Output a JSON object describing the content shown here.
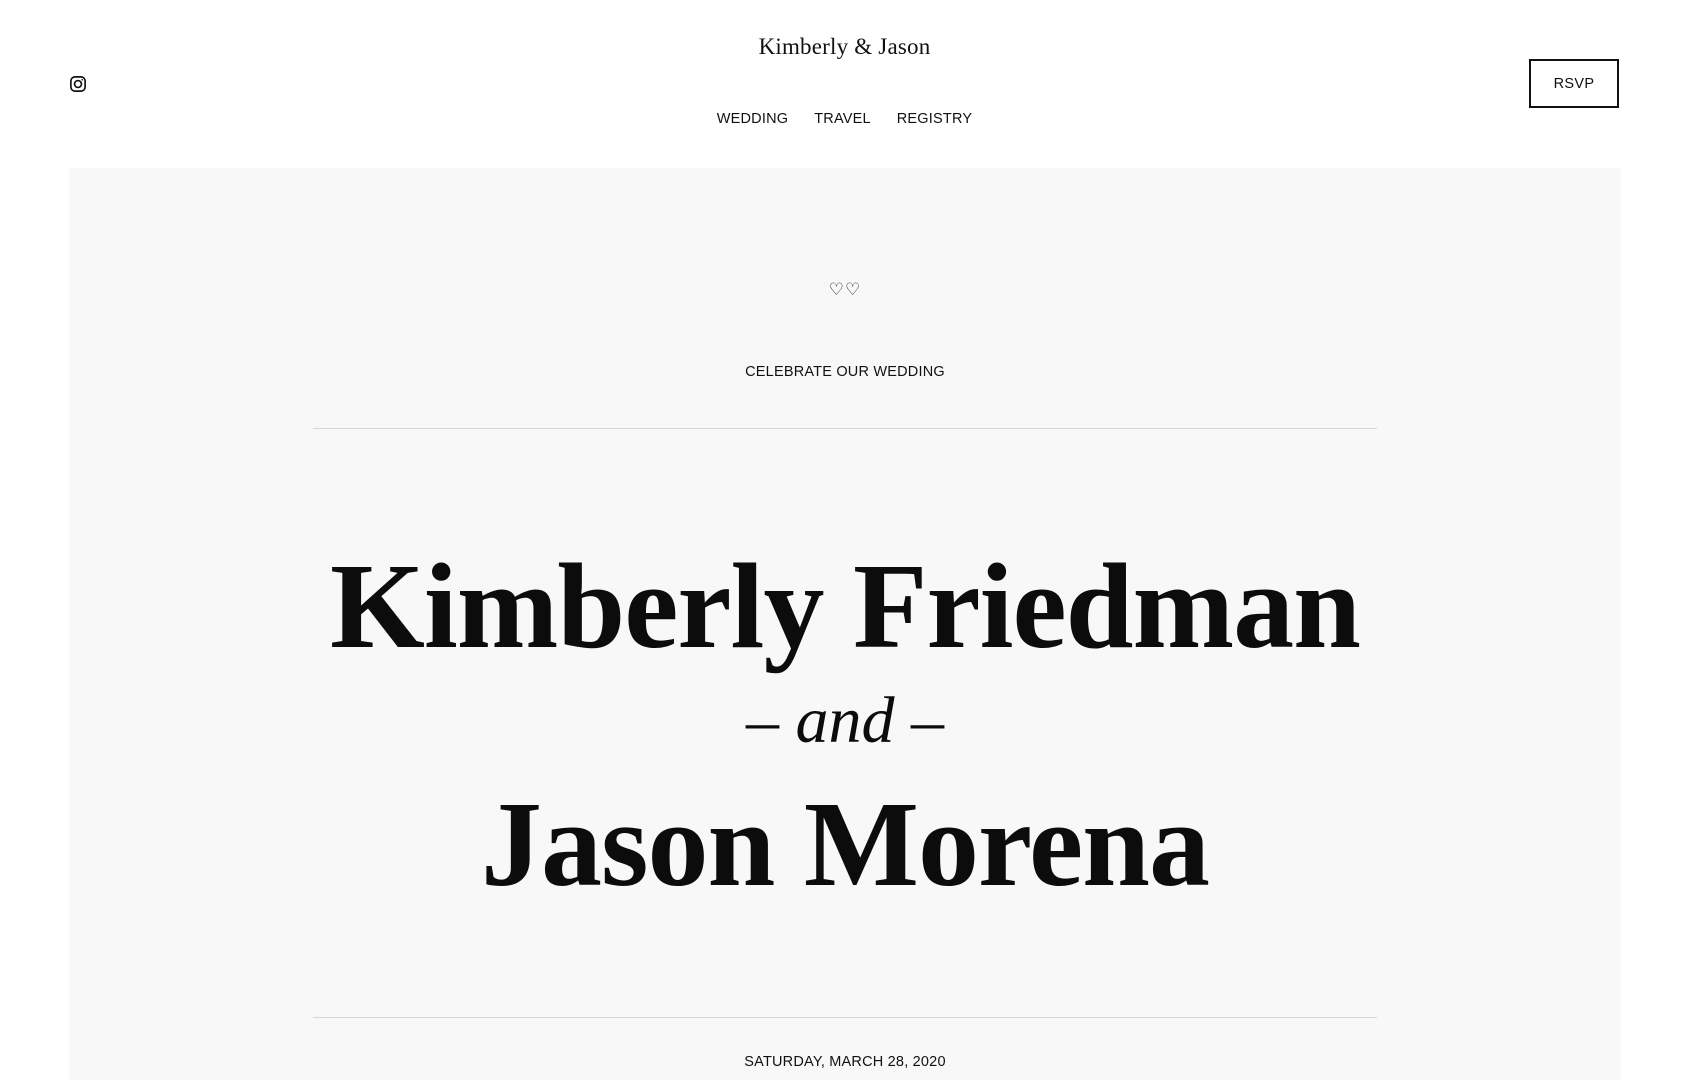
{
  "header": {
    "site_title": "Kimberly & Jason",
    "social_icon": "instagram-icon",
    "nav": [
      {
        "label": "WEDDING"
      },
      {
        "label": "TRAVEL"
      },
      {
        "label": "REGISTRY"
      }
    ],
    "rsvp_label": "RSVP"
  },
  "hero": {
    "hearts": "♡♡",
    "eyebrow": "CELEBRATE OUR WEDDING",
    "partner_one": "Kimberly Friedman",
    "conjunction": "– and –",
    "partner_two": "Jason Morena",
    "date": "SATURDAY, MARCH 28, 2020"
  },
  "colors": {
    "text": "#111111",
    "hero_background": "#f8f8f8",
    "divider": "#d6d6d6",
    "page_background": "#ffffff"
  }
}
